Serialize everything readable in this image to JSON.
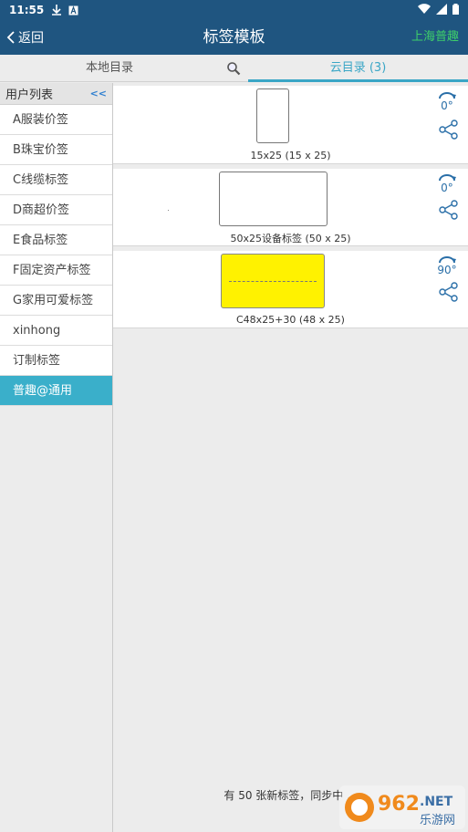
{
  "status": {
    "time": "11:55",
    "icons": [
      "download-icon",
      "a-icon",
      "wifi-icon",
      "signal-icon",
      "battery-icon"
    ]
  },
  "header": {
    "back_label": "返回",
    "title": "标签模板",
    "right_link": "上海普趣"
  },
  "tabs": [
    {
      "label": "本地目录",
      "active": false
    },
    {
      "label": "云目录 (3)",
      "active": true
    }
  ],
  "sidebar": {
    "header": "用户列表",
    "collapse": "<<",
    "items": [
      {
        "label": "A服装价签",
        "active": false
      },
      {
        "label": "B珠宝价签",
        "active": false
      },
      {
        "label": "C线缆标签",
        "active": false
      },
      {
        "label": "D商超价签",
        "active": false
      },
      {
        "label": "E食品标签",
        "active": false
      },
      {
        "label": "F固定资产标签",
        "active": false
      },
      {
        "label": "G家用可爱标签",
        "active": false
      },
      {
        "label": "xinhong",
        "active": false
      },
      {
        "label": "订制标签",
        "active": false
      },
      {
        "label": "普趣@通用",
        "active": true
      }
    ]
  },
  "templates": [
    {
      "caption": "15x25 (15 x 25)",
      "rotation": "0°",
      "color": "#ffffff"
    },
    {
      "caption": "50x25设备标签 (50 x 25)",
      "rotation": "0°",
      "color": "#ffffff"
    },
    {
      "caption": "C48x25+30 (48 x 25)",
      "rotation": "90°",
      "color": "#fff200"
    }
  ],
  "sync_text": "有 50 张新标签，同步中 ...",
  "watermark": {
    "text": "962.NET",
    "subtext": "乐游网"
  },
  "colors": {
    "header_bg": "#1f5580",
    "accent": "#3aafca",
    "right_link": "#3ecf6a"
  }
}
